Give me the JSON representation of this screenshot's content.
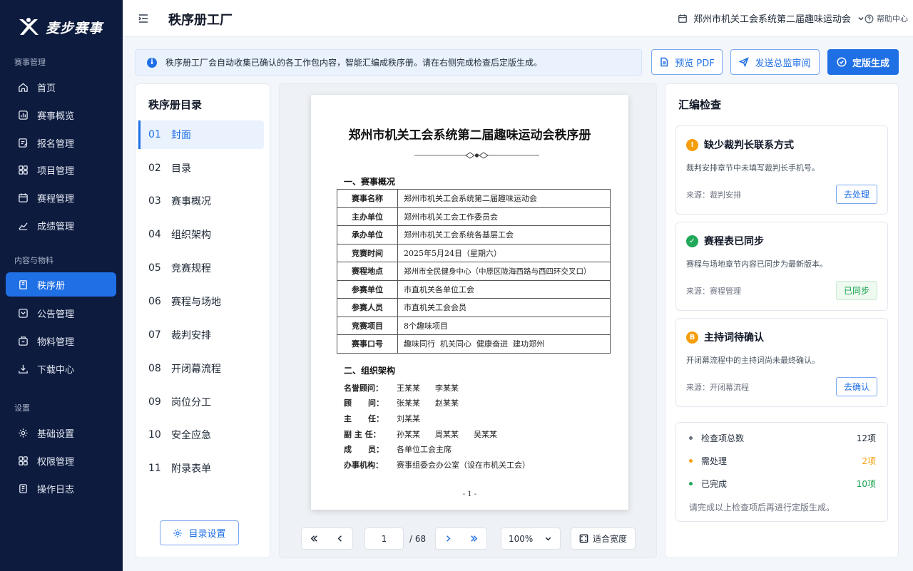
{
  "brand": {
    "name": "麦步赛事"
  },
  "sidebar": {
    "sections": [
      {
        "title": "赛事管理",
        "items": [
          {
            "label": "首页",
            "icon": "home-icon"
          },
          {
            "label": "赛事概览",
            "icon": "overview-icon"
          },
          {
            "label": "报名管理",
            "icon": "signup-icon"
          },
          {
            "label": "项目管理",
            "icon": "grid-icon"
          },
          {
            "label": "赛程管理",
            "icon": "calendar-icon"
          },
          {
            "label": "成绩管理",
            "icon": "chart-icon"
          }
        ]
      },
      {
        "title": "内容与物料",
        "items": [
          {
            "label": "秩序册",
            "icon": "book-icon",
            "active": true
          },
          {
            "label": "公告管理",
            "icon": "notice-icon"
          },
          {
            "label": "物料管理",
            "icon": "box-icon"
          },
          {
            "label": "下载中心",
            "icon": "download-icon"
          }
        ]
      },
      {
        "title": "设置",
        "items": [
          {
            "label": "基础设置",
            "icon": "gear-icon"
          },
          {
            "label": "权限管理",
            "icon": "grid-icon"
          },
          {
            "label": "操作日志",
            "icon": "log-icon"
          }
        ]
      }
    ]
  },
  "header": {
    "title": "秩序册工厂",
    "event": "郑州市机关工会系统第二届趣味运动会",
    "help": "帮助中心"
  },
  "notice": "秩序册工厂会自动收集已确认的各工作包内容，智能汇编成秩序册。请在右侧完成检查后定版生成。",
  "actions": {
    "preview_pdf": "预览 PDF",
    "send_review": "发送总监审阅",
    "finalize": "定版生成"
  },
  "toc": {
    "title": "秩序册目录",
    "items": [
      {
        "num": "01",
        "label": "封面"
      },
      {
        "num": "02",
        "label": "目录"
      },
      {
        "num": "03",
        "label": "赛事概况"
      },
      {
        "num": "04",
        "label": "组织架构"
      },
      {
        "num": "05",
        "label": "竞赛规程"
      },
      {
        "num": "06",
        "label": "赛程与场地"
      },
      {
        "num": "07",
        "label": "裁判安排"
      },
      {
        "num": "08",
        "label": "开闭幕流程"
      },
      {
        "num": "09",
        "label": "岗位分工"
      },
      {
        "num": "10",
        "label": "安全应急"
      },
      {
        "num": "11",
        "label": "附录表单"
      }
    ],
    "settings_button": "目录设置"
  },
  "document": {
    "title": "郑州市机关工会系统第二届趣味运动会秩序册",
    "section1": "一、赛事概况",
    "table": [
      {
        "k": "赛事名称",
        "v": "郑州市机关工会系统第二届趣味运动会"
      },
      {
        "k": "主办单位",
        "v": "郑州市机关工会工作委员会"
      },
      {
        "k": "承办单位",
        "v": "郑州市机关工会系统各基层工会"
      },
      {
        "k": "竞赛时间",
        "v": "2025年5月24日（星期六）"
      },
      {
        "k": "赛程地点",
        "v": "郑州市全民健身中心（中原区陇海西路与西四环交叉口）"
      },
      {
        "k": "参赛单位",
        "v": "市直机关各单位工会"
      },
      {
        "k": "参赛人员",
        "v": "市直机关工会会员"
      },
      {
        "k": "竞赛项目",
        "v": "8个趣味项目"
      },
      {
        "k": "赛事口号",
        "v": "趣味同行  机关同心  健康奋进  建功郑州"
      }
    ],
    "section2": "二、组织架构",
    "org": [
      {
        "k": "名誉顾问：",
        "v": "王某某      李某某"
      },
      {
        "k": "顾      问：",
        "v": "张某某      赵某某"
      },
      {
        "k": "主      任：",
        "v": "刘某某"
      },
      {
        "k": "副 主 任：",
        "v": "孙某某      周某某      吴某某"
      },
      {
        "k": "成      员：",
        "v": "各单位工会主席"
      },
      {
        "k": "办事机构：",
        "v": "赛事组委会办公室（设在市机关工会）"
      }
    ],
    "page_label": "- 1 -"
  },
  "pager": {
    "current": "1",
    "total": "/ 68",
    "zoom": "100%",
    "fit": "适合宽度"
  },
  "checks": {
    "title": "汇编检查",
    "cards": [
      {
        "title": "缺少裁判长联系方式",
        "desc": "裁判安排章节中未填写裁判长手机号。",
        "source": "来源：裁判安排",
        "action": "去处理",
        "status": "warning",
        "color": "#f59e0b"
      },
      {
        "title": "赛程表已同步",
        "desc": "赛程与场地章节内容已同步为最新版本。",
        "source": "来源：赛程管理",
        "action": "已同步",
        "status": "ok",
        "color": "#22a85a"
      },
      {
        "title": "主持词待确认",
        "desc": "开闭幕流程中的主持词尚未最终确认。",
        "source": "来源：开闭幕流程",
        "action": "去确认",
        "status": "pending",
        "color": "#f59e0b"
      }
    ],
    "summary": [
      {
        "label": "检查项总数",
        "value": "12项",
        "color": "#6b7280",
        "valcolor": "#1f2937"
      },
      {
        "label": "需处理",
        "value": "2项",
        "color": "#f59e0b",
        "valcolor": "#f59e0b"
      },
      {
        "label": "已完成",
        "value": "10项",
        "color": "#22a85a",
        "valcolor": "#16a34a"
      }
    ],
    "note": "请完成以上检查项后再进行定版生成。"
  }
}
